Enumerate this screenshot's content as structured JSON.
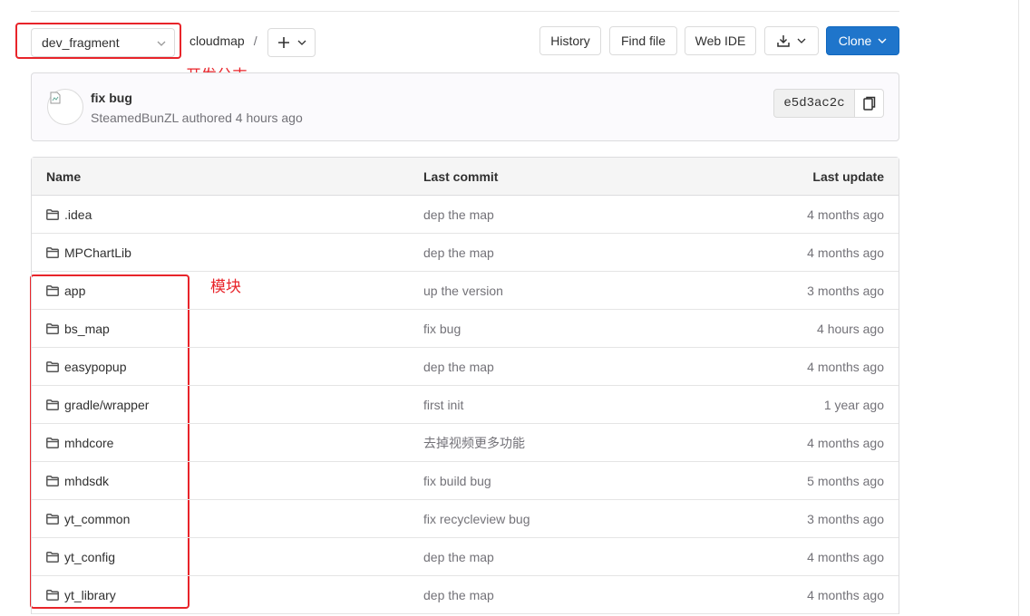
{
  "toolbar": {
    "branch": "dev_fragment",
    "repo": "cloudmap",
    "separator": "/",
    "history_label": "History",
    "find_file_label": "Find file",
    "web_ide_label": "Web IDE",
    "clone_label": "Clone",
    "icons": {
      "add": "plus-icon",
      "download": "download-icon",
      "dropdown": "chevron-down-icon"
    }
  },
  "annotations": {
    "branch_note": "开发分支",
    "modules_note": "模块",
    "color": "#e8242a"
  },
  "commit": {
    "title": "fix bug",
    "meta": "SteamedBunZL authored 4 hours ago",
    "sha": "e5d3ac2c"
  },
  "table": {
    "headers": {
      "name": "Name",
      "last_commit": "Last commit",
      "last_update": "Last update"
    },
    "rows": [
      {
        "name": ".idea",
        "commit": "dep the map",
        "updated": "4 months ago"
      },
      {
        "name": "MPChartLib",
        "commit": "dep the map",
        "updated": "4 months ago"
      },
      {
        "name": "app",
        "commit": "up the version",
        "updated": "3 months ago"
      },
      {
        "name": "bs_map",
        "commit": "fix bug",
        "updated": "4 hours ago"
      },
      {
        "name": "easypopup",
        "commit": "dep the map",
        "updated": "4 months ago"
      },
      {
        "name": "gradle/wrapper",
        "commit": "first init",
        "updated": "1 year ago"
      },
      {
        "name": "mhdcore",
        "commit": "去掉视频更多功能",
        "updated": "4 months ago"
      },
      {
        "name": "mhdsdk",
        "commit": "fix build bug",
        "updated": "5 months ago"
      },
      {
        "name": "yt_common",
        "commit": "fix recycleview bug",
        "updated": "3 months ago"
      },
      {
        "name": "yt_config",
        "commit": "dep the map",
        "updated": "4 months ago"
      },
      {
        "name": "yt_library",
        "commit": "dep the map",
        "updated": "4 months ago"
      }
    ]
  },
  "colors": {
    "primary": "#1f75cb",
    "annotation": "#e8242a"
  }
}
